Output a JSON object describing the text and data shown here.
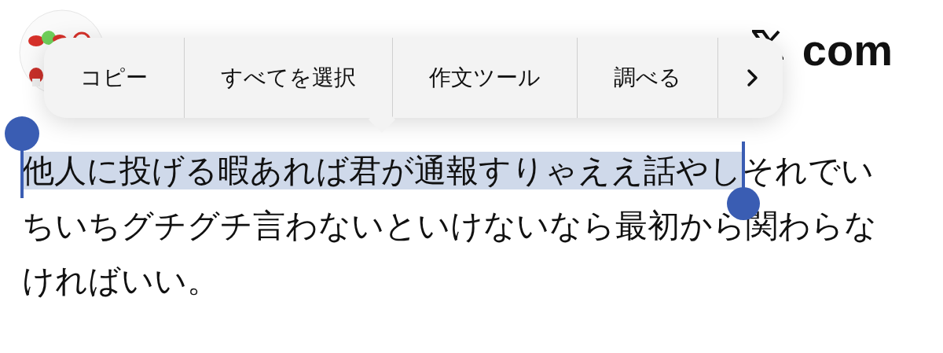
{
  "header": {
    "site": "com"
  },
  "menu": {
    "items": [
      {
        "label": "コピー"
      },
      {
        "label": "すべてを選択"
      },
      {
        "label": "作文ツール"
      },
      {
        "label": "調べる"
      }
    ],
    "has_more": true
  },
  "post": {
    "segments": [
      {
        "text": "他人に投げる暇あれば君が通報すりゃええ話やし",
        "selected": true
      },
      {
        "text": "それでいちいちグチグチ言わないといけないなら最初から関わらなければいい。",
        "selected": false
      }
    ]
  }
}
